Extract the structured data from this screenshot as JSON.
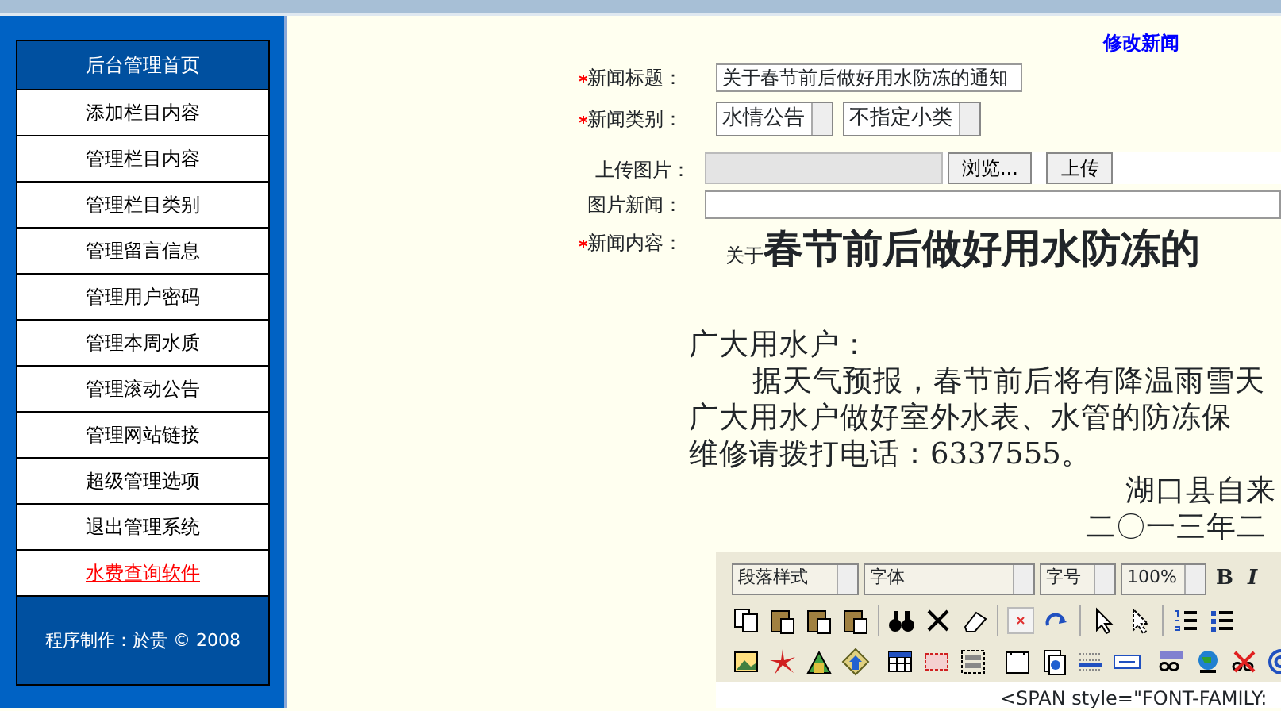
{
  "page_title": "修改新闻",
  "sidebar": {
    "items": [
      {
        "label": "后台管理首页",
        "kind": "header"
      },
      {
        "label": "添加栏目内容",
        "kind": "link"
      },
      {
        "label": "管理栏目内容",
        "kind": "link"
      },
      {
        "label": "管理栏目类别",
        "kind": "link"
      },
      {
        "label": "管理留言信息",
        "kind": "link"
      },
      {
        "label": "管理用户密码",
        "kind": "link"
      },
      {
        "label": "管理本周水质",
        "kind": "link"
      },
      {
        "label": "管理滚动公告",
        "kind": "link"
      },
      {
        "label": "管理网站链接",
        "kind": "link"
      },
      {
        "label": "超级管理选项",
        "kind": "link"
      },
      {
        "label": "退出管理系统",
        "kind": "link"
      },
      {
        "label": "水费查询软件",
        "kind": "highlight"
      }
    ],
    "footer": "程序制作：於贵 © 2008"
  },
  "form": {
    "fields": [
      {
        "kind": "text",
        "label": "新闻标题：",
        "required": true,
        "value": "关于春节前后做好用水防冻的通知"
      },
      {
        "kind": "selects",
        "label": "新闻类别：",
        "required": true,
        "options": [
          "水情公告",
          "不指定小类"
        ]
      },
      {
        "kind": "upload",
        "label": "上传图片：",
        "required": false,
        "buttons": [
          "浏览...",
          "上传"
        ]
      },
      {
        "kind": "wide",
        "label": "图片新闻：",
        "required": false
      },
      {
        "kind": "editor",
        "label": "新闻内容：",
        "required": true
      }
    ]
  },
  "editor": {
    "heading_small": "关于",
    "heading": "春节前后做好用水防冻的",
    "greeting": "广大用水户：",
    "body": [
      {
        "text": "据天气预报，春节前后将有降温雨雪天",
        "indent": true
      },
      {
        "text": "广大用水户做好室外水表、水管的防冻保",
        "indent": false
      },
      {
        "text": "维修请拨打电话：6337555。",
        "indent": false
      }
    ],
    "signature": [
      "湖口县自来",
      "二〇一三年二"
    ],
    "toolbar": {
      "dropdowns": [
        "段落样式",
        "字体",
        "字号",
        "100%"
      ],
      "format_buttons": [
        "B",
        "I"
      ]
    },
    "source_text": "<SPAN style=\"FONT-FAMILY:"
  }
}
